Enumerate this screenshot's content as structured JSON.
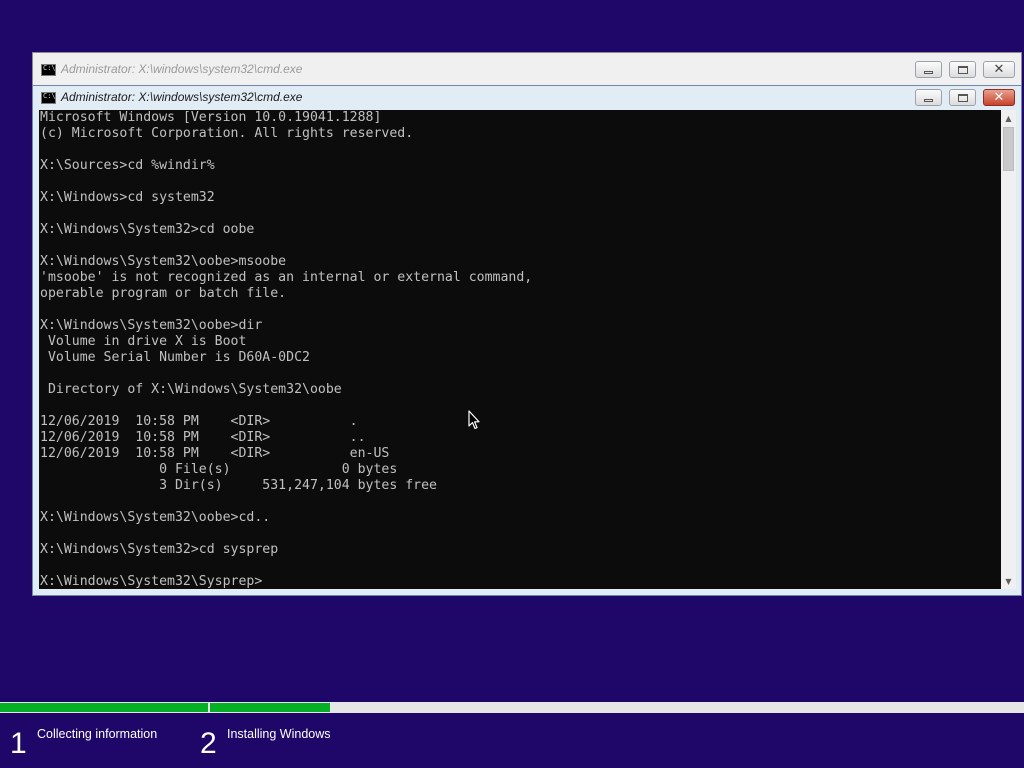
{
  "background_window": {
    "title": "Administrator: X:\\windows\\system32\\cmd.exe"
  },
  "cmd_window": {
    "title": "Administrator: X:\\windows\\system32\\cmd.exe",
    "icon": "cmd-icon",
    "controls": [
      "minimize-icon",
      "maximize-icon",
      "close-icon"
    ],
    "console_text": "Microsoft Windows [Version 10.0.19041.1288]\n(c) Microsoft Corporation. All rights reserved.\n\nX:\\Sources>cd %windir%\n\nX:\\Windows>cd system32\n\nX:\\Windows\\System32>cd oobe\n\nX:\\Windows\\System32\\oobe>msoobe\n'msoobe' is not recognized as an internal or external command,\noperable program or batch file.\n\nX:\\Windows\\System32\\oobe>dir\n Volume in drive X is Boot\n Volume Serial Number is D60A-0DC2\n\n Directory of X:\\Windows\\System32\\oobe\n\n12/06/2019  10:58 PM    <DIR>          .\n12/06/2019  10:58 PM    <DIR>          ..\n12/06/2019  10:58 PM    <DIR>          en-US\n               0 File(s)              0 bytes\n               3 Dir(s)     531,247,104 bytes free\n\nX:\\Windows\\System32\\oobe>cd..\n\nX:\\Windows\\System32>cd sysprep\n\nX:\\Windows\\System32\\Sysprep>"
  },
  "colors": {
    "desktop": "#1f0769",
    "progress_fill": "#06b025",
    "console_bg": "#0c0c0c",
    "console_text": "#c0c0c0"
  },
  "setup": {
    "steps": [
      {
        "number": "1",
        "label": "Collecting information",
        "progress": 1.0
      },
      {
        "number": "2",
        "label": "Installing Windows",
        "progress": 0.148
      }
    ]
  }
}
